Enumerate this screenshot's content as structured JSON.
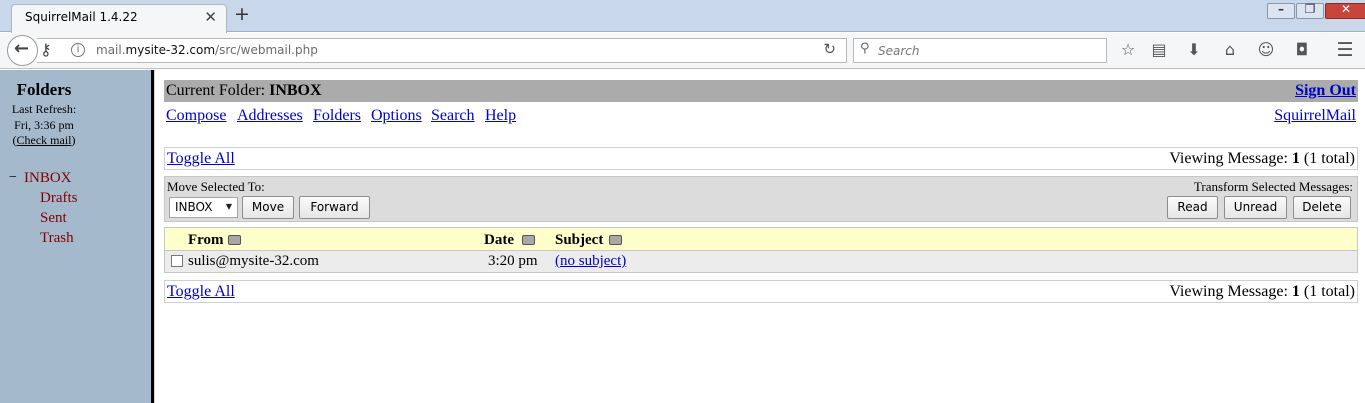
{
  "browser": {
    "tab_title": "SquirrelMail 1.4.22",
    "tab_close": "✕",
    "new_tab": "+",
    "url_prefix": "mail.",
    "url_domain": "mysite-32.com",
    "url_path": "/src/webmail.php",
    "search_placeholder": "Search",
    "icons": [
      "back-arrow-icon",
      "key-icon",
      "info-icon",
      "reload-icon",
      "search-icon",
      "star-icon",
      "reading-list-icon",
      "download-icon",
      "home-icon",
      "hello-icon",
      "pocket-icon",
      "menu-icon"
    ]
  },
  "sidebar": {
    "title": "Folders",
    "last_refresh_label": "Last Refresh:",
    "last_refresh_time": "Fri, 3:36 pm",
    "check_mail": "Check mail",
    "collapse_symbol": "−",
    "folders": [
      {
        "label": "INBOX"
      },
      {
        "label": "Drafts"
      },
      {
        "label": "Sent"
      },
      {
        "label": "Trash"
      }
    ],
    "folder_color": "#800000"
  },
  "main": {
    "current_folder_label": "Current Folder:",
    "current_folder": "INBOX",
    "sign_out": "Sign Out",
    "menu": [
      "Compose",
      "Addresses",
      "Folders",
      "Options",
      "Search",
      "Help"
    ],
    "brand_link": "SquirrelMail",
    "toggle_all": "Toggle All",
    "viewing_prefix": "Viewing Message:",
    "viewing_num": "1",
    "viewing_suffix": "(1 total)",
    "move_selected_label": "Move Selected To:",
    "move_select_value": "INBOX",
    "move_button": "Move",
    "forward_button": "Forward",
    "transform_label": "Transform Selected Messages:",
    "read_button": "Read",
    "unread_button": "Unread",
    "delete_button": "Delete",
    "columns": {
      "from": "From",
      "date": "Date",
      "subject": "Subject"
    },
    "messages": [
      {
        "from": "sulis@mysite-32.com",
        "date": "3:20 pm",
        "subject": "(no subject)",
        "selected": false
      }
    ]
  },
  "colors": {
    "header_bar": "#ababab",
    "link": "#0000cc",
    "sidebar_bg": "#a4b9cc",
    "table_header_bg": "#ffffcc"
  }
}
